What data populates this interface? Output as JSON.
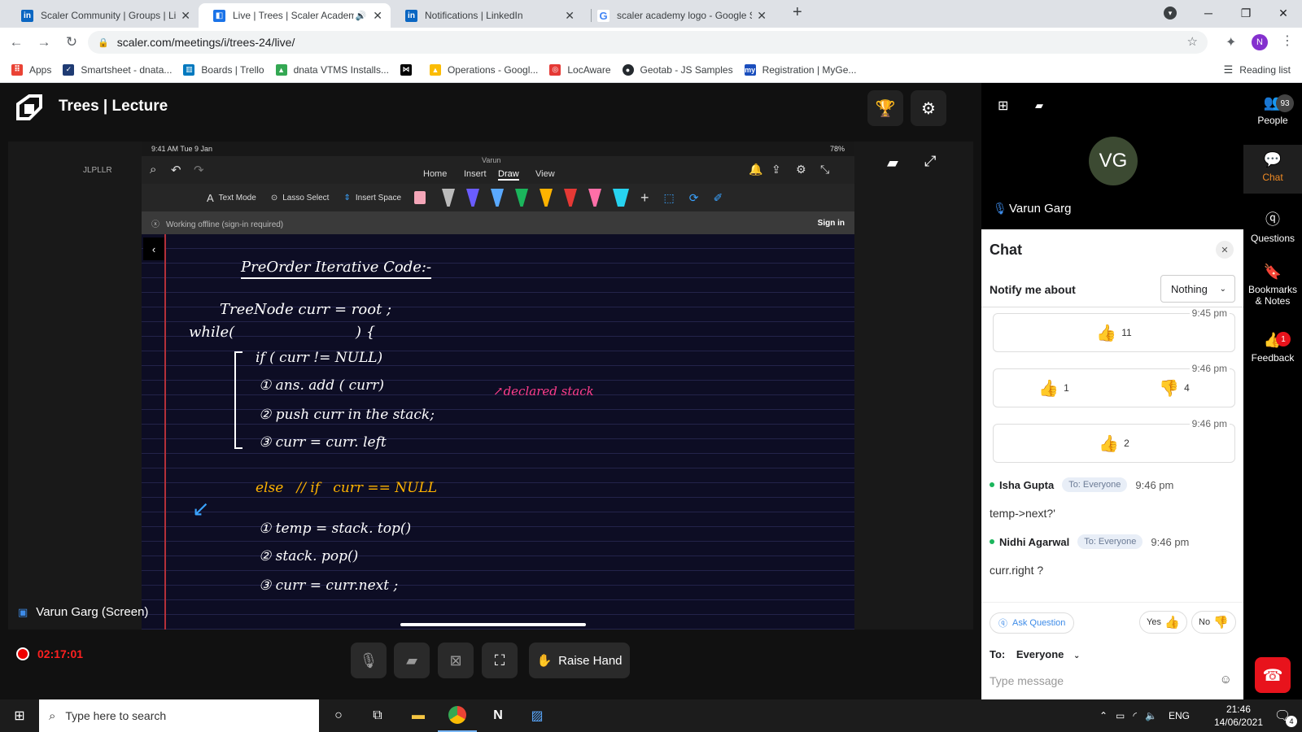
{
  "browser": {
    "tabs": [
      {
        "title": "Scaler Community | Groups | Link",
        "favicon": "linkedin-icon",
        "color": "#0a66c2",
        "active": false
      },
      {
        "title": "Live | Trees | Scaler Academy",
        "favicon": "scaler-icon",
        "color": "#1a73e8",
        "active": true
      },
      {
        "title": "Notifications | LinkedIn",
        "favicon": "linkedin-icon",
        "color": "#0a66c2",
        "active": false
      },
      {
        "title": "scaler academy logo - Google Se",
        "favicon": "google-icon",
        "color": "#4285f4",
        "active": false
      }
    ],
    "url": "scaler.com/meetings/i/trees-24/live/",
    "profile_initial": "N",
    "bookmarks": [
      {
        "label": "Apps",
        "color": "#ea4335"
      },
      {
        "label": "Smartsheet - dnata...",
        "color": "#1f3b73"
      },
      {
        "label": "Boards | Trello",
        "color": "#0079bf"
      },
      {
        "label": "dnata VTMS Installs...",
        "color": "#34a853"
      },
      {
        "label": "",
        "color": "#000000"
      },
      {
        "label": "Operations - Googl...",
        "color": "#fbbc04"
      },
      {
        "label": "LocAware",
        "color": "#e53935"
      },
      {
        "label": "Geotab - JS Samples",
        "color": "#24292e"
      },
      {
        "label": "Registration | MyGe...",
        "color": "#1a4ebd"
      }
    ],
    "reading_list": "Reading list"
  },
  "lecture": {
    "title": "Trees | Lecture",
    "presenter_screen_label": "Varun Garg (Screen)",
    "recording_time": "02:17:01",
    "raise_hand_label": "Raise Hand"
  },
  "ipad": {
    "status_time": "9:41 AM  Tue 9 Jan",
    "battery": "78%",
    "doc_owner": "Varun",
    "left_label": "JLPLLR",
    "menu": [
      "Home",
      "Insert",
      "Draw",
      "View"
    ],
    "active_menu": "Draw",
    "tools": [
      "Text Mode",
      "Lasso Select",
      "Insert Space"
    ],
    "offline_text": "Working offline (sign-in required)",
    "sign_in": "Sign in"
  },
  "notebook": {
    "title": "PreOrder Iterative Code:-",
    "lines": [
      "TreeNode curr =  root ;",
      "while(                          ) {",
      "if ( curr != NULL)",
      "① ans. add ( curr)",
      "② push curr in the stack;",
      "③ curr =  curr. left",
      "else   // if   curr == NULL",
      "① temp = stack. top()",
      "② stack. pop()",
      "③ curr = curr.next ;"
    ],
    "annotation": "declared stack"
  },
  "presenter": {
    "initials": "VG",
    "name": "Varun Garg"
  },
  "chat": {
    "title": "Chat",
    "notify_label": "Notify me about",
    "notify_value": "Nothing",
    "reactions": [
      {
        "time": "9:45 pm",
        "items": [
          {
            "type": "thumbs-up",
            "count": "11"
          }
        ]
      },
      {
        "time": "9:46 pm",
        "items": [
          {
            "type": "thumbs-up",
            "count": "1"
          },
          {
            "type": "thumbs-down",
            "count": "4"
          }
        ]
      },
      {
        "time": "9:46 pm",
        "items": [
          {
            "type": "thumbs-up",
            "count": "2"
          }
        ]
      }
    ],
    "messages": [
      {
        "name": "Isha Gupta",
        "to": "To: Everyone",
        "time": "9:46 pm",
        "text": "temp->next?'"
      },
      {
        "name": "Nidhi Agarwal",
        "to": "To: Everyone",
        "time": "9:46 pm",
        "text": "curr.right ?"
      }
    ],
    "ask_question": "Ask Question",
    "yes": "Yes",
    "no": "No",
    "to_label": "To:",
    "to_value": "Everyone",
    "input_placeholder": "Type message"
  },
  "sidenav": {
    "people": "People",
    "people_count": "93",
    "chat": "Chat",
    "questions": "Questions",
    "bookmarks": "Bookmarks",
    "bookmarks_sub": "& Notes",
    "feedback": "Feedback",
    "feedback_badge": "1"
  },
  "taskbar": {
    "search_placeholder": "Type here to search",
    "lang": "ENG",
    "time": "21:46",
    "date": "14/06/2021",
    "notif_count": "4"
  },
  "colors": {
    "accent_orange": "#f08a24",
    "recording_red": "#ff2020",
    "end_call_red": "#e8131c",
    "online_green": "#1bb55c",
    "ink_pink": "#ff3d8b",
    "ink_yellow": "#ffb300",
    "ink_blue": "#3aa3ff"
  }
}
